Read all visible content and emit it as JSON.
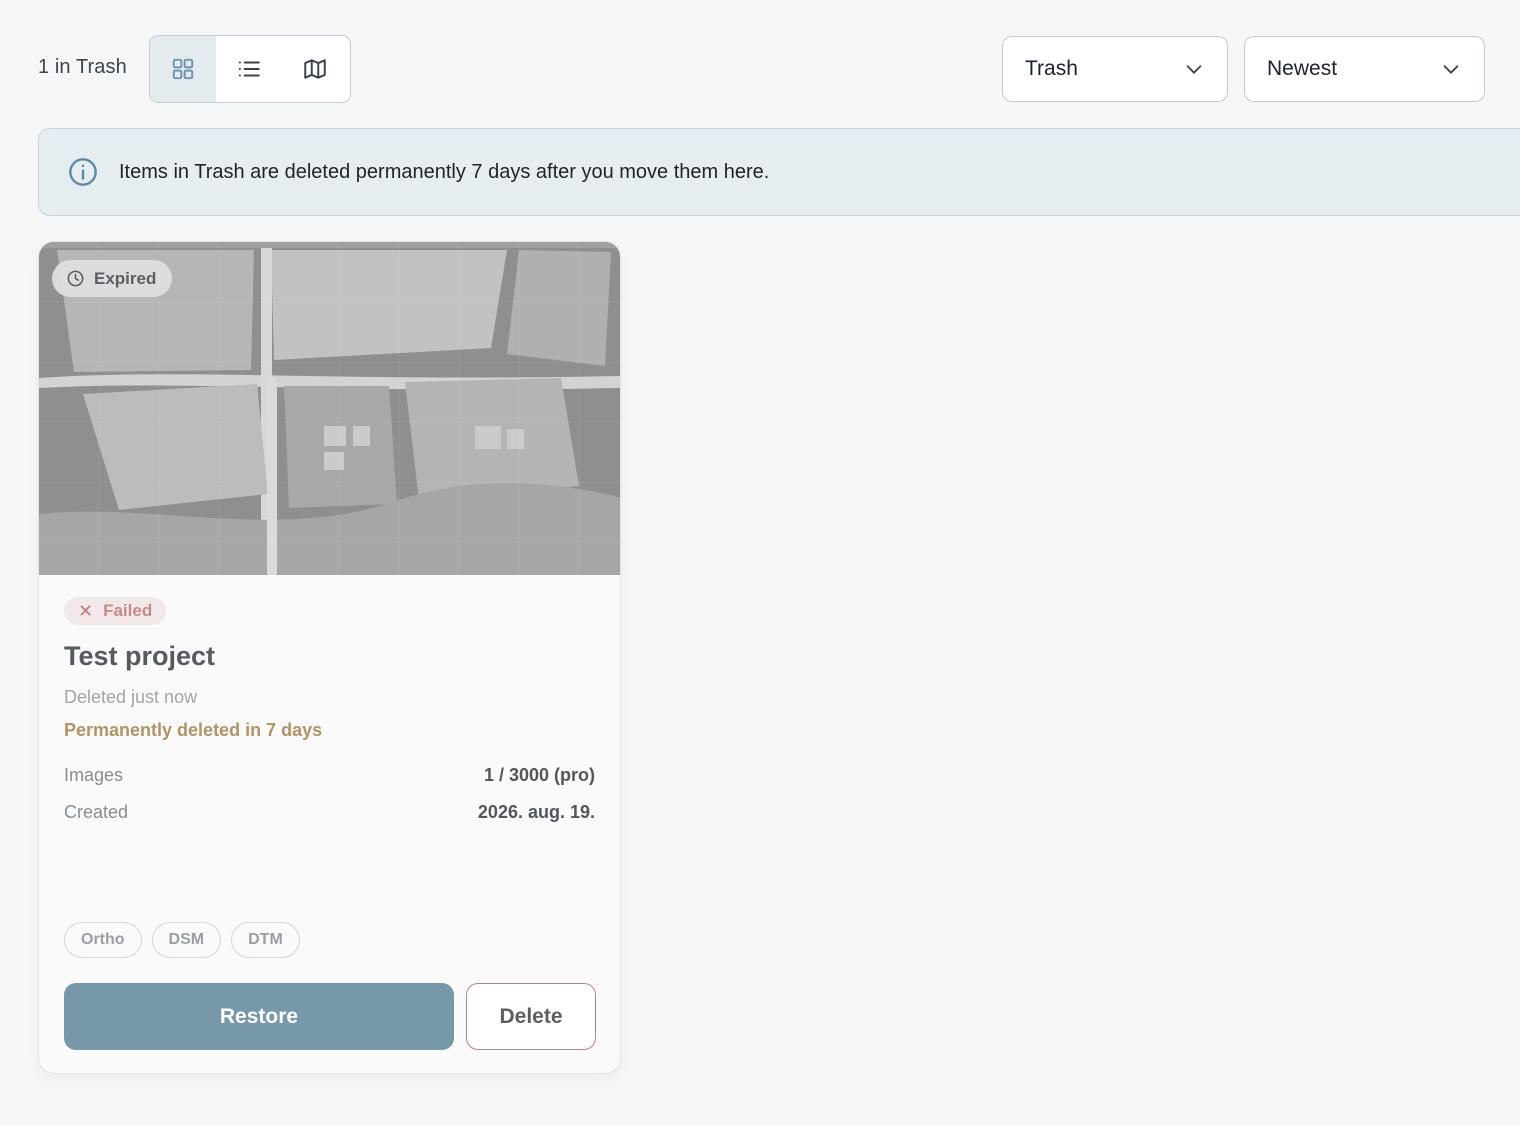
{
  "header": {
    "count_label": "1 in Trash",
    "view_modes": [
      {
        "name": "grid",
        "icon": "grid-icon",
        "active": true
      },
      {
        "name": "list",
        "icon": "list-icon",
        "active": false
      },
      {
        "name": "map",
        "icon": "map-icon",
        "active": false
      }
    ],
    "filter_dropdown": {
      "selected": "Trash",
      "icon": "chevron-down-icon"
    },
    "sort_dropdown": {
      "selected": "Newest",
      "icon": "chevron-down-icon"
    }
  },
  "info_banner": {
    "icon": "info-icon",
    "text": "Items in Trash are deleted permanently 7 days after you move them here."
  },
  "projects": [
    {
      "thumbnail_badge": {
        "icon": "clock-icon",
        "label": "Expired"
      },
      "status": {
        "icon": "close-icon",
        "symbol": "✕",
        "label": "Failed"
      },
      "title": "Test project",
      "deleted": "Deleted just now",
      "permanent_deletion": "Permanently deleted in 7 days",
      "meta": [
        {
          "key": "Images",
          "value": "1 / 3000 (pro)"
        },
        {
          "key": "Created",
          "value": "2026. aug. 19."
        }
      ],
      "tags": [
        "Ortho",
        "DSM",
        "DTM"
      ],
      "actions": {
        "restore": "Restore",
        "delete": "Delete"
      }
    }
  ],
  "colors": {
    "accent": "#7797ab",
    "failed": "#c58b8b",
    "warning_text": "#b09367",
    "background": "#f5f6f8"
  }
}
